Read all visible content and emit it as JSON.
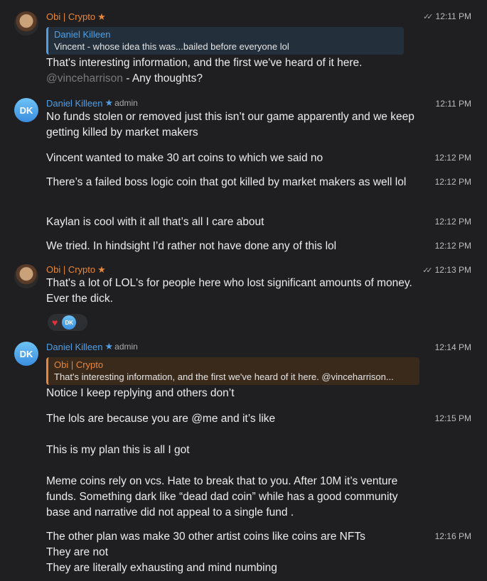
{
  "colors": {
    "background": "#1f1f21",
    "obi_name": "#e8873a",
    "dk_name": "#4f9fe6",
    "reaction_heart": "#e0313b"
  },
  "messages": [
    {
      "author": "Obi | Crypto",
      "time": "12:11 PM",
      "read": true,
      "reply_to": {
        "author": "Daniel Killeen",
        "text": "Vincent - whose idea this was...bailed before everyone lol"
      },
      "text_line1": "That's interesting information, and the first we've heard of it here.",
      "mention": "@vinceharrison",
      "text_line2_rest": " - Any thoughts?"
    },
    {
      "author": "Daniel Killeen",
      "role": "admin",
      "avatar_initials": "DK",
      "time": "12:11 PM",
      "text": "No funds stolen or removed just this isn’t our game apparently and we keep getting killed by market makers"
    },
    {
      "time": "12:12 PM",
      "text": "Vincent wanted to make 30 art coins to which we said no"
    },
    {
      "time": "12:12 PM",
      "text": "There’s a failed boss logic coin that got killed by market makers as well lol"
    },
    {
      "time": "12:12 PM",
      "text": "Kaylan is cool with it all that’s all I care about"
    },
    {
      "time": "12:12 PM",
      "text": "We tried. In hindsight I’d rather not have done any of this lol"
    },
    {
      "author": "Obi | Crypto",
      "time": "12:13 PM",
      "read": true,
      "text": "That's a lot of LOL's for people here who lost significant amounts of money. Ever the dick.",
      "reaction": {
        "emoji": "♥",
        "by": "DK"
      }
    },
    {
      "author": "Daniel Killeen",
      "role": "admin",
      "avatar_initials": "DK",
      "time": "12:14 PM",
      "reply_to": {
        "author": "Obi | Crypto",
        "text": "That's interesting information, and the first we've heard of it here. @vinceharrison..."
      },
      "text": "Notice I keep replying and others don’t"
    },
    {
      "time": "12:15 PM",
      "lines": [
        "The lols are because you are @me and it’s like",
        "",
        "This is my plan this is all I got",
        "",
        "Meme coins rely on vcs. Hate to break that to you. After 10M it’s venture funds. Something dark like “dead dad coin” while has a good community base and narrative did not appeal to a single fund ."
      ]
    },
    {
      "time": "12:16 PM",
      "lines": [
        "The other plan was make 30 other artist coins like coins are NFTs",
        "They are not",
        "They are literally exhausting and mind numbing"
      ]
    }
  ]
}
